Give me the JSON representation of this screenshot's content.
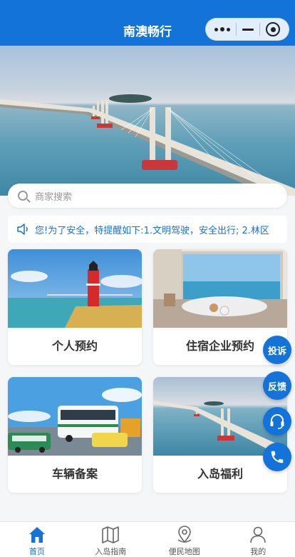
{
  "header": {
    "title": "南澳畅行"
  },
  "capsule": {
    "more_icon": "more-dots-icon",
    "minimize_icon": "minimize-icon",
    "close_icon": "target-close-icon"
  },
  "search": {
    "placeholder": "商家搜索"
  },
  "notice": {
    "text": "您!为了安全，特提醒如下:1.文明驾驶，安全出行; 2.林区"
  },
  "cards": [
    {
      "label": "个人预约"
    },
    {
      "label": "住宿企业预约"
    },
    {
      "label": "车辆备案"
    },
    {
      "label": "入岛福利"
    }
  ],
  "floating": {
    "complaint": "投诉",
    "feedback": "反馈",
    "service_icon": "headset-icon",
    "phone_icon": "phone-icon"
  },
  "tabbar": [
    {
      "label": "首页",
      "icon": "home-icon",
      "active": true
    },
    {
      "label": "入岛指南",
      "icon": "map-icon"
    },
    {
      "label": "便民地图",
      "icon": "location-pin-icon"
    },
    {
      "label": "我的",
      "icon": "user-icon"
    }
  ],
  "colors": {
    "primary": "#1473d8"
  }
}
